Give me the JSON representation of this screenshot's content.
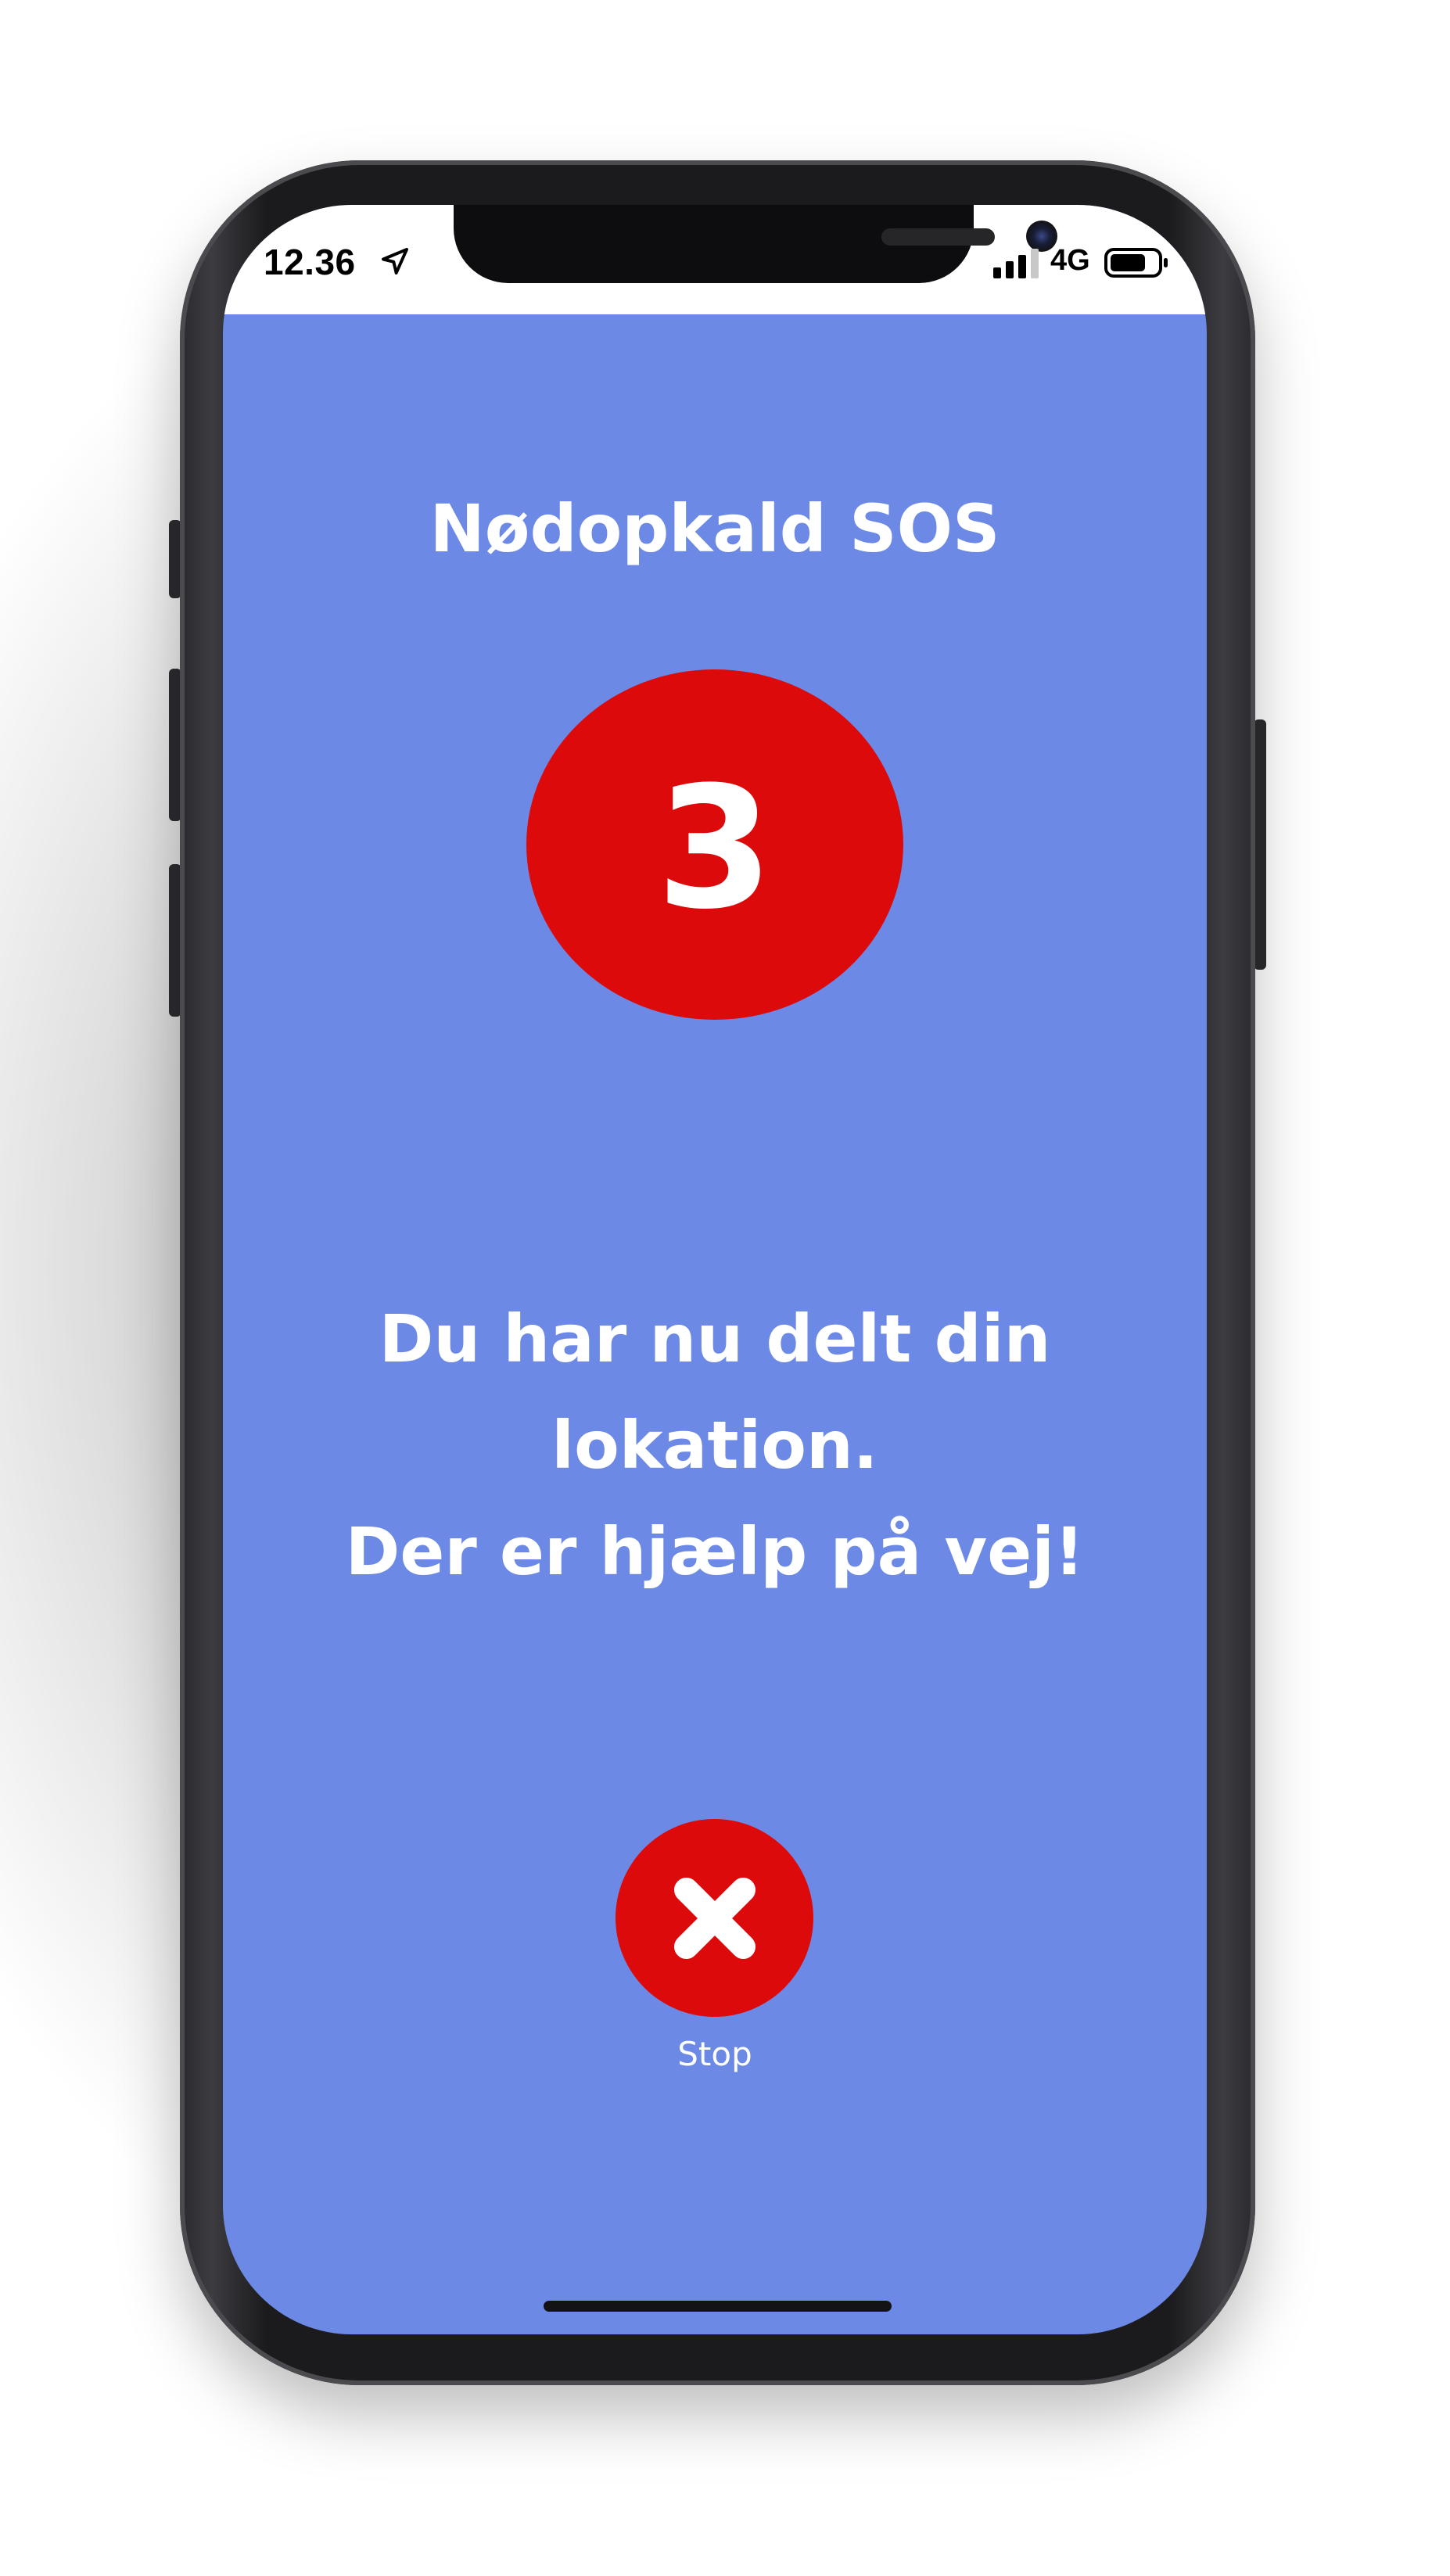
{
  "status_bar": {
    "time": "12.36",
    "network": "4G",
    "location_icon": "location-arrow-icon",
    "signal_icon": "cellular-signal-icon",
    "battery_icon": "battery-icon"
  },
  "screen": {
    "title": "Nødopkald SOS",
    "countdown": "3",
    "message_line1": "Du har nu delt din lokation.",
    "message_line2": "Der er hjælp på vej!",
    "stop_icon": "close-icon",
    "stop_label": "Stop"
  },
  "colors": {
    "background": "#6d89e6",
    "accent_red": "#dc0a0a",
    "text": "#ffffff"
  }
}
